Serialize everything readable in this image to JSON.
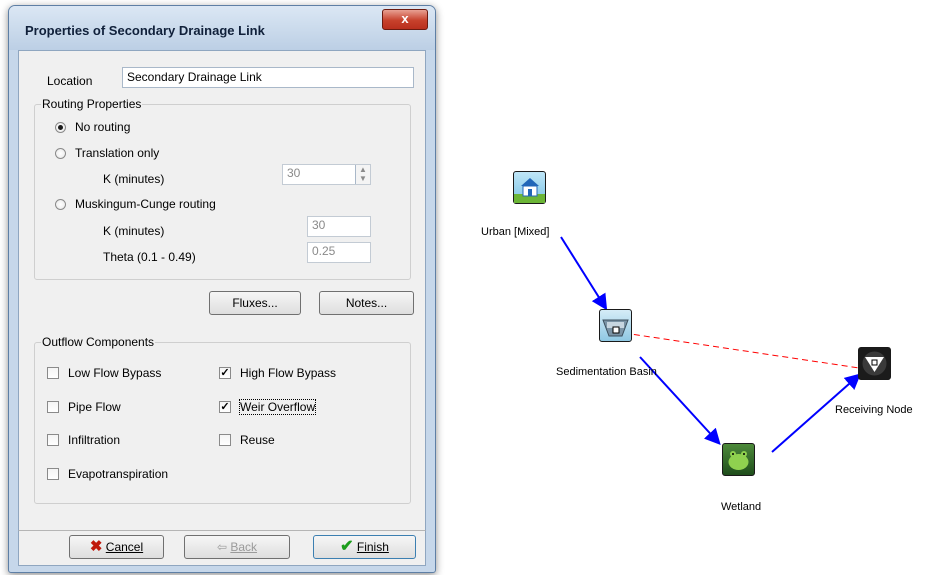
{
  "dialog": {
    "title": "Properties of Secondary Drainage Link",
    "close_label": "x",
    "location": {
      "label": "Location",
      "value": "Secondary Drainage Link"
    },
    "routing": {
      "title": "Routing Properties",
      "no_routing": "No routing",
      "translation_only": "Translation only",
      "translation_k_label": "K (minutes)",
      "translation_k_value": "30",
      "muskingum": "Muskingum-Cunge routing",
      "muskingum_k_label": "K (minutes)",
      "muskingum_k_value": "30",
      "theta_label": "Theta (0.1 - 0.49)",
      "theta_value": "0.25",
      "selected": "No routing"
    },
    "fluxes_button": "Fluxes...",
    "notes_button": "Notes...",
    "outflow": {
      "title": "Outflow Components",
      "low_flow_bypass": "Low Flow Bypass",
      "high_flow_bypass": "High Flow Bypass",
      "pipe_flow": "Pipe Flow",
      "weir_overflow": "Weir Overflow",
      "infiltration": "Infiltration",
      "reuse": "Reuse",
      "evapotranspiration": "Evapotranspiration",
      "checked": [
        "High Flow Bypass",
        "Weir Overflow"
      ]
    },
    "buttons": {
      "cancel": "Cancel",
      "back": "Back",
      "finish": "Finish"
    }
  },
  "diagram": {
    "nodes": {
      "urban": "Urban [Mixed]",
      "sedimentation": "Sedimentation Basin",
      "receiving": "Receiving Node",
      "wetland": "Wetland"
    },
    "colors": {
      "primary_link": "#0000ff",
      "secondary_link": "#ff0000"
    }
  }
}
